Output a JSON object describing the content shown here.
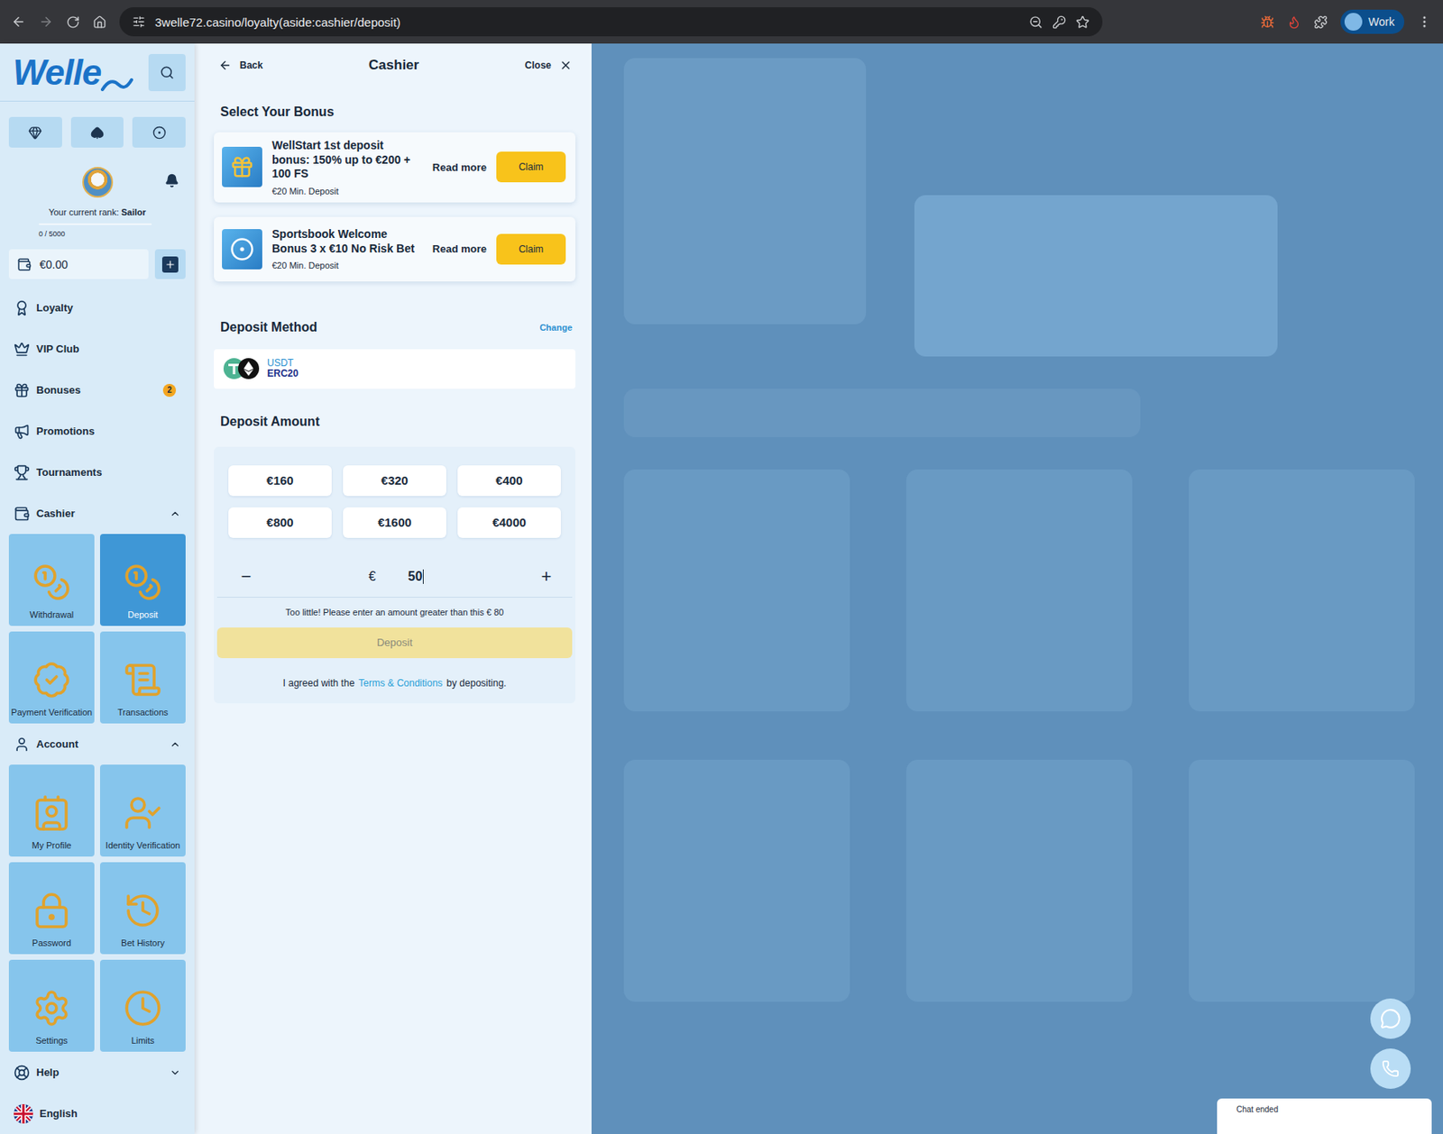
{
  "browser": {
    "url": "3welle72.casino/loyalty(aside:cashier/deposit)",
    "profile": "Work"
  },
  "sidebar": {
    "logo": "Welle",
    "rank_label": "Your current rank:",
    "rank": "Sailor",
    "progress": "0 / 5000",
    "level": 0,
    "balance": "€0.00",
    "menu": [
      {
        "label": "Loyalty",
        "badge": ""
      },
      {
        "label": "VIP Club",
        "badge": ""
      },
      {
        "label": "Bonuses",
        "badge": "2"
      },
      {
        "label": "Promotions",
        "badge": ""
      },
      {
        "label": "Tournaments",
        "badge": ""
      }
    ],
    "cashier": {
      "label": "Cashier",
      "expanded": true,
      "tiles": [
        {
          "label": "Withdrawal",
          "selected": false
        },
        {
          "label": "Deposit",
          "selected": true
        },
        {
          "label": "Payment Verification",
          "selected": false
        },
        {
          "label": "Transactions",
          "selected": false
        }
      ]
    },
    "account": {
      "label": "Account",
      "expanded": true,
      "tiles": [
        {
          "label": "My Profile",
          "selected": false
        },
        {
          "label": "Identity Verification",
          "selected": false
        },
        {
          "label": "Password",
          "selected": false
        },
        {
          "label": "Bet History",
          "selected": false
        },
        {
          "label": "Settings",
          "selected": false
        },
        {
          "label": "Limits",
          "selected": false
        }
      ]
    },
    "help": {
      "label": "Help",
      "expanded": false
    },
    "language": "English"
  },
  "cashier_panel": {
    "back": "Back",
    "title": "Cashier",
    "close": "Close",
    "bonus_heading": "Select Your Bonus",
    "bonuses": [
      {
        "title": "WellStart 1st deposit bonus: 150% up to €200 + 100 FS",
        "min": "€20 Min. Deposit",
        "read_more": "Read more",
        "claim": "Claim"
      },
      {
        "title": "Sportsbook Welcome Bonus 3 x €10 No Risk Bet",
        "min": "€20 Min. Deposit",
        "read_more": "Read more",
        "claim": "Claim"
      }
    ],
    "method_heading": "Deposit Method",
    "change": "Change",
    "method": {
      "currency": "USDT",
      "network": "ERC20"
    },
    "amount_heading": "Deposit Amount",
    "presets": [
      {
        "label": "€160",
        "selected": false
      },
      {
        "label": "€320",
        "selected": false
      },
      {
        "label": "€400",
        "selected": false
      },
      {
        "label": "€800",
        "selected": false
      },
      {
        "label": "€1600",
        "selected": false
      },
      {
        "label": "€4000",
        "selected": false
      }
    ],
    "minus": "−",
    "currency": "€",
    "amount": "50",
    "plus": "+",
    "error": "Too little! Please enter an amount greater than this € 80",
    "deposit": {
      "label": "Deposit",
      "disabled": true
    },
    "terms": {
      "before": "I agreed with the",
      "link": "Terms & Conditions",
      "after": "by depositing."
    }
  },
  "chat": {
    "status": "Chat ended"
  }
}
